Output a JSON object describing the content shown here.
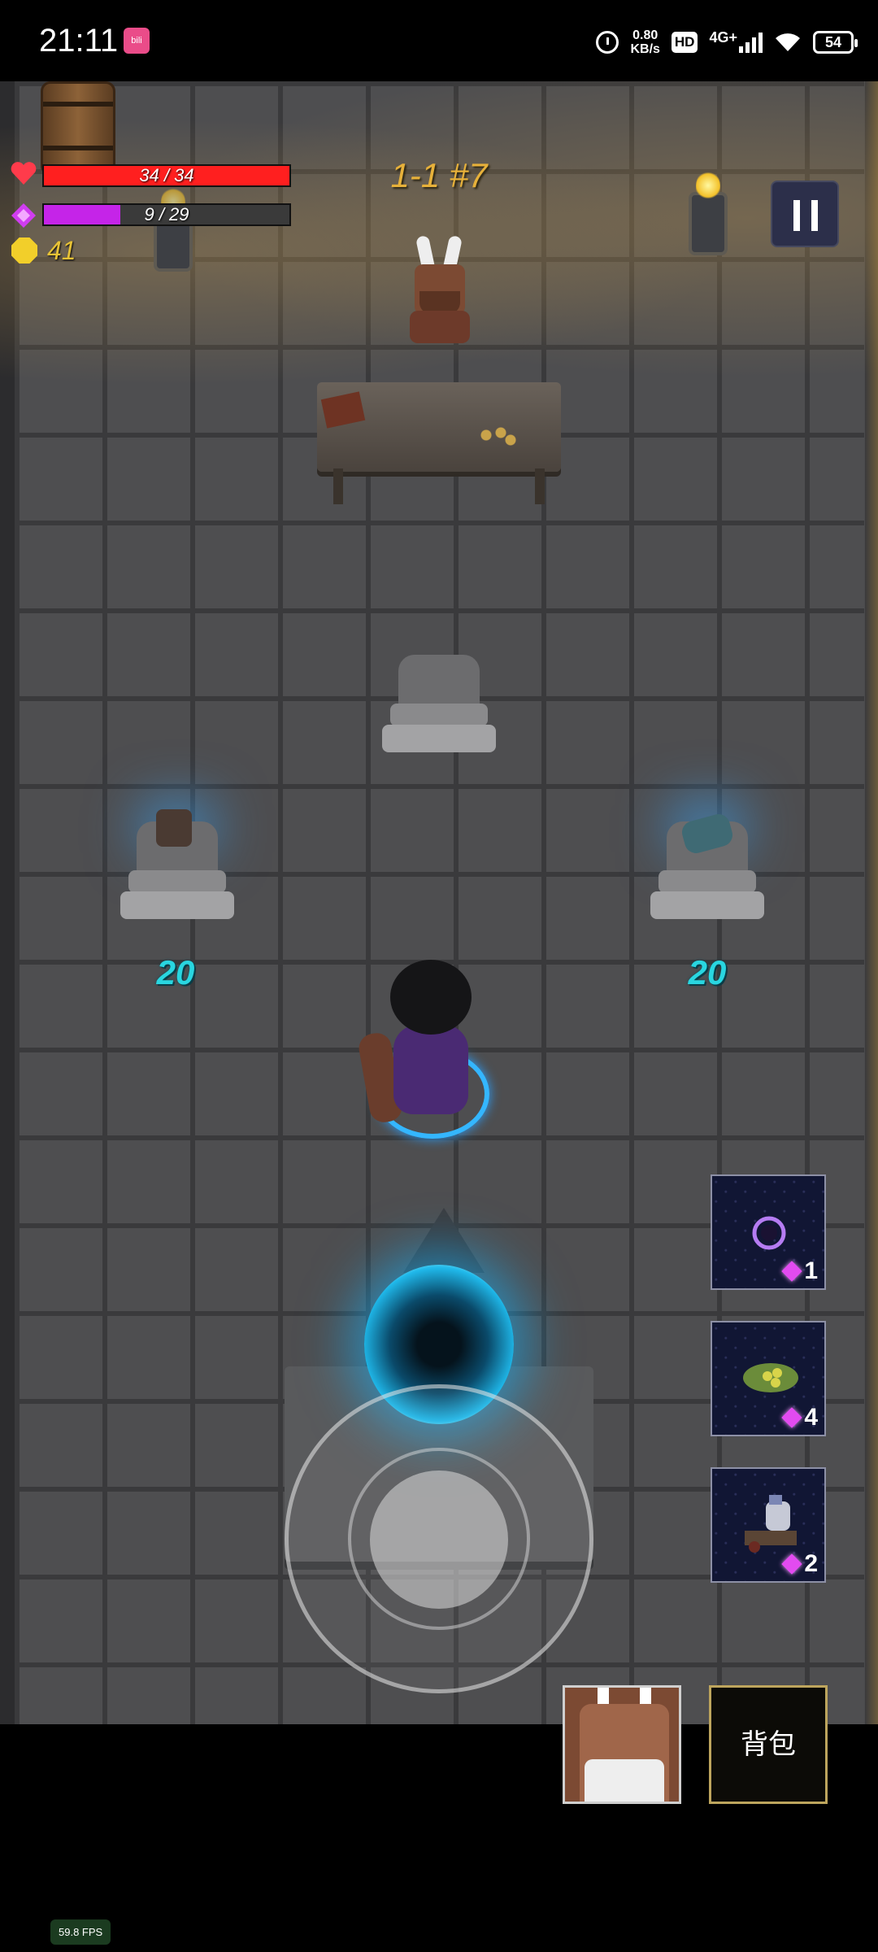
{
  "status_bar": {
    "time": "21:11",
    "app_icon": "bilibili-app-icon",
    "net_speed_value": "0.80",
    "net_speed_unit": "KB/s",
    "hd_badge": "HD",
    "network_type": "4G+",
    "battery": "54"
  },
  "hud": {
    "hp_text": "34 / 34",
    "hp_fraction": 1.0,
    "mana_text": "9 / 29",
    "mana_fraction": 0.31,
    "gold": "41",
    "level": "1-1 #7",
    "colors": {
      "hp": "#ff1f1f",
      "mana": "#c524e8",
      "gold": "#e7c236",
      "price": "#29d6e0"
    }
  },
  "shop": {
    "left_price": "20",
    "right_price": "20"
  },
  "skills": [
    {
      "icon": "void-orb-icon",
      "cost": "1"
    },
    {
      "icon": "seed-pod-icon",
      "cost": "4"
    },
    {
      "icon": "cart-creature-icon",
      "cost": "2"
    }
  ],
  "buttons": {
    "bag_label": "背包",
    "npc_icon": "shopkeeper-portrait"
  },
  "debug": {
    "fps": "59.8 FPS"
  }
}
